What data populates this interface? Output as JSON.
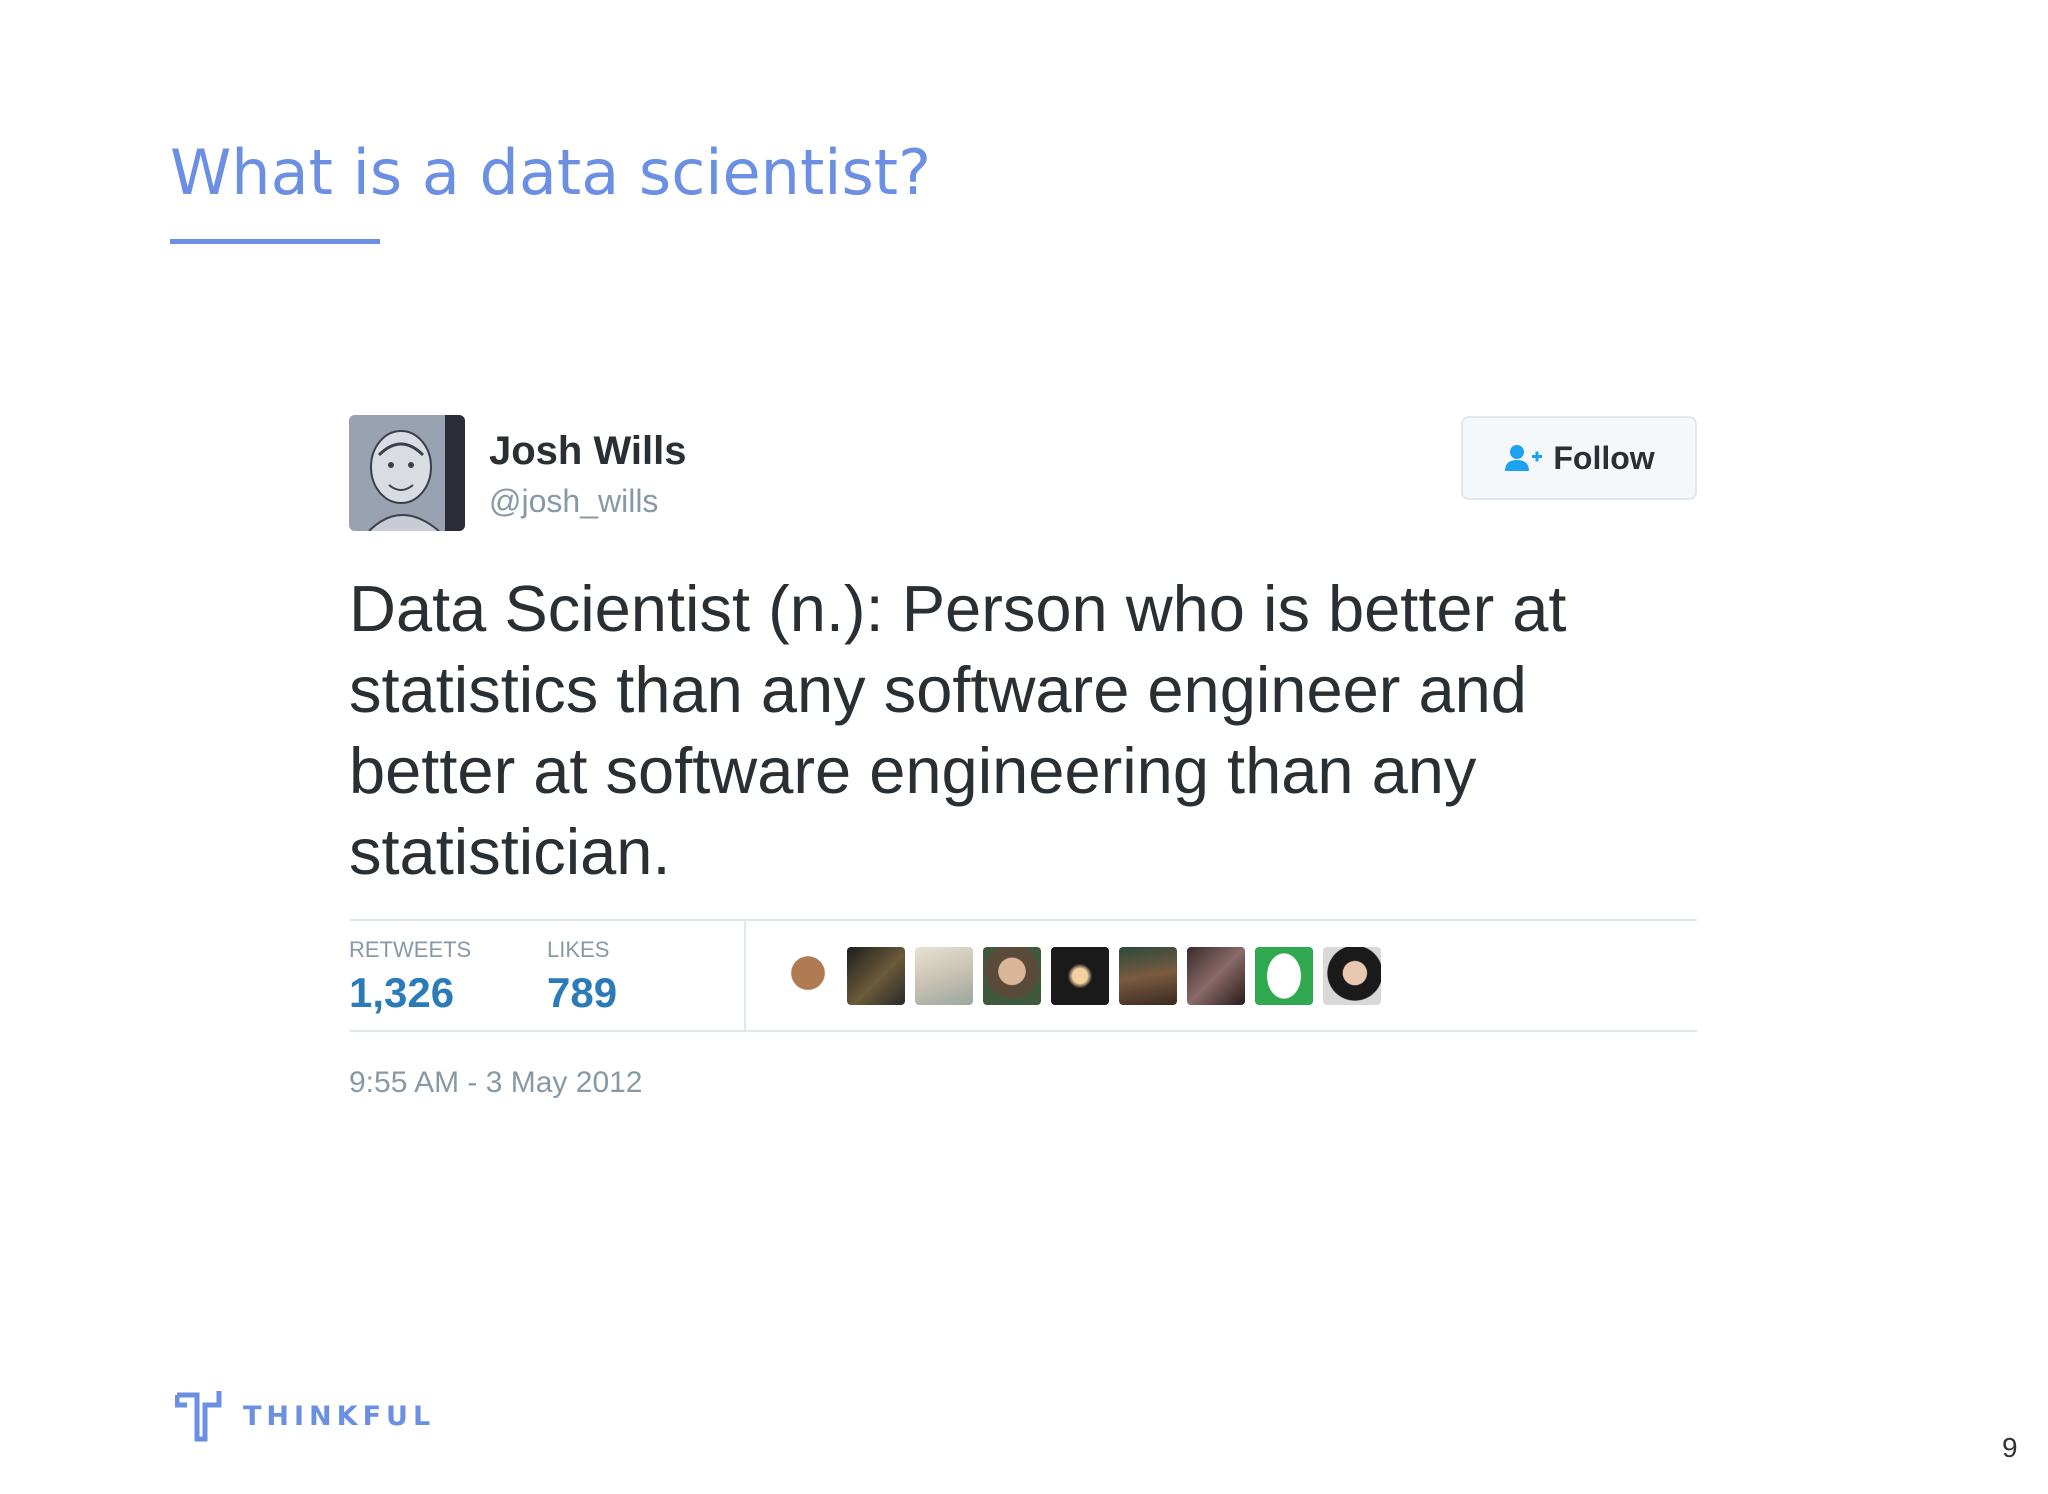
{
  "slide": {
    "title": "What is a data scientist?",
    "page_number": "9",
    "accent_color": "#6b8fe3"
  },
  "tweet": {
    "author_name": "Josh Wills",
    "author_handle": "@josh_wills",
    "follow_label": "Follow",
    "follow_icon": "add-user-icon",
    "text": "Data Scientist (n.): Person who is better at statistics than any software engineer and better at software engineering than any statistician.",
    "retweets_label": "RETWEETS",
    "retweets_count": "1,326",
    "likes_label": "LIKES",
    "likes_count": "789",
    "timestamp": "9:55 AM - 3 May 2012",
    "liker_avatar_count_shown": 9
  },
  "footer": {
    "brand": "THINKFUL",
    "brand_icon": "thinkful-logo-icon"
  }
}
